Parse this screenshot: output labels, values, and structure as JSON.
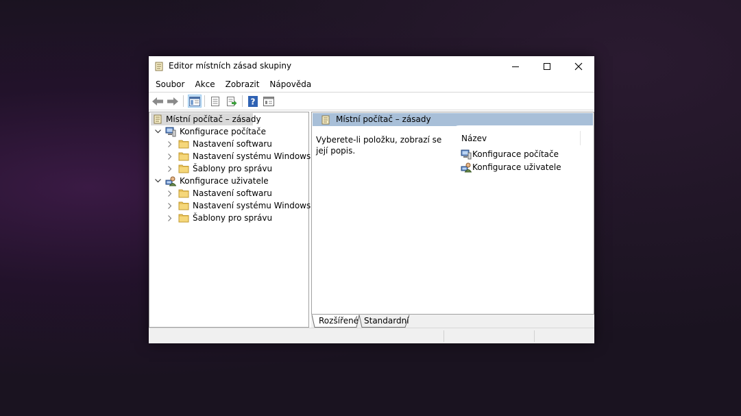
{
  "window": {
    "title": "Editor místních zásad skupiny"
  },
  "menu": {
    "items": [
      "Soubor",
      "Akce",
      "Zobrazit",
      "Nápověda"
    ]
  },
  "tree": {
    "root": "Místní počítač – zásady",
    "computer": {
      "label": "Konfigurace počítače",
      "children": [
        "Nastavení softwaru",
        "Nastavení systému Windows",
        "Šablony pro správu"
      ]
    },
    "user": {
      "label": "Konfigurace uživatele",
      "children": [
        "Nastavení softwaru",
        "Nastavení systému Windows",
        "Šablony pro správu"
      ]
    }
  },
  "right": {
    "header": "Místní počítač – zásady",
    "description": "Vyberete-li položku, zobrazí se její popis.",
    "column": "Název",
    "items": [
      "Konfigurace počítače",
      "Konfigurace uživatele"
    ]
  },
  "tabs": [
    "Rozšířené",
    "Standardní"
  ],
  "colors": {
    "selection": "#d9d9d9",
    "header_band": "#a8bfd8",
    "folder": "#e8c15b",
    "help_icon": "#2f62b3"
  }
}
